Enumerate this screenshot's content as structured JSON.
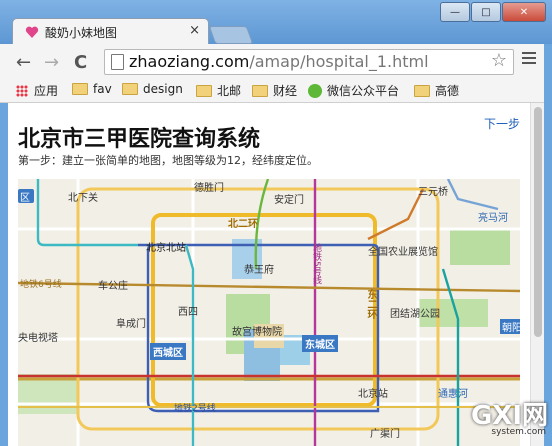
{
  "tab": {
    "title": "酸奶小妹地图",
    "close": "×"
  },
  "toolbar": {
    "back": "←",
    "forward": "→",
    "reload": "C",
    "url_host": "zhaoziang.com",
    "url_path": "/amap/hospital_1.html",
    "star": "☆"
  },
  "window": {
    "minimize": "—",
    "maximize": "□",
    "close": "✕"
  },
  "bookmarks": {
    "apps": "应用",
    "items": [
      "fav",
      "design",
      "北邮",
      "财经",
      "微信公众平台",
      "高德"
    ]
  },
  "page": {
    "title": "北京市三甲医院查询系统",
    "next_link": "下一步",
    "step_text": "第一步：建立一张简单的地图，地图等级为12，经纬度定位。"
  },
  "map": {
    "labels": {
      "beixiaguan": "北下关",
      "deshengmen": "德胜门",
      "andingmen": "安定门",
      "erhuan": "北二环",
      "sanyuanqiao": "三元桥",
      "liangmahe": "亮马河",
      "beijingnorth": "北京北站",
      "ditie5": "地铁5号线",
      "ditie6": "地铁6号线",
      "gongwangfu": "恭王府",
      "nongye": "全国农业展览馆",
      "chegongzhuang": "车公庄",
      "xisi": "西四",
      "donghuan": "东二环",
      "fuchengmen": "阜成门",
      "tuanjiehu": "团结湖公园",
      "cctv": "央电视塔",
      "gugong": "故宫博物院",
      "chaoyang": "朝阳",
      "xicheng": "西城区",
      "dongcheng": "东城区",
      "beijingzhan": "北京站",
      "ditie2": "地铁2号线",
      "tonghuihe": "通惠河",
      "guangqumen": "广渠门",
      "lu_left": "区"
    }
  },
  "watermark": {
    "main": "GXI网",
    "sub": "system.com"
  }
}
